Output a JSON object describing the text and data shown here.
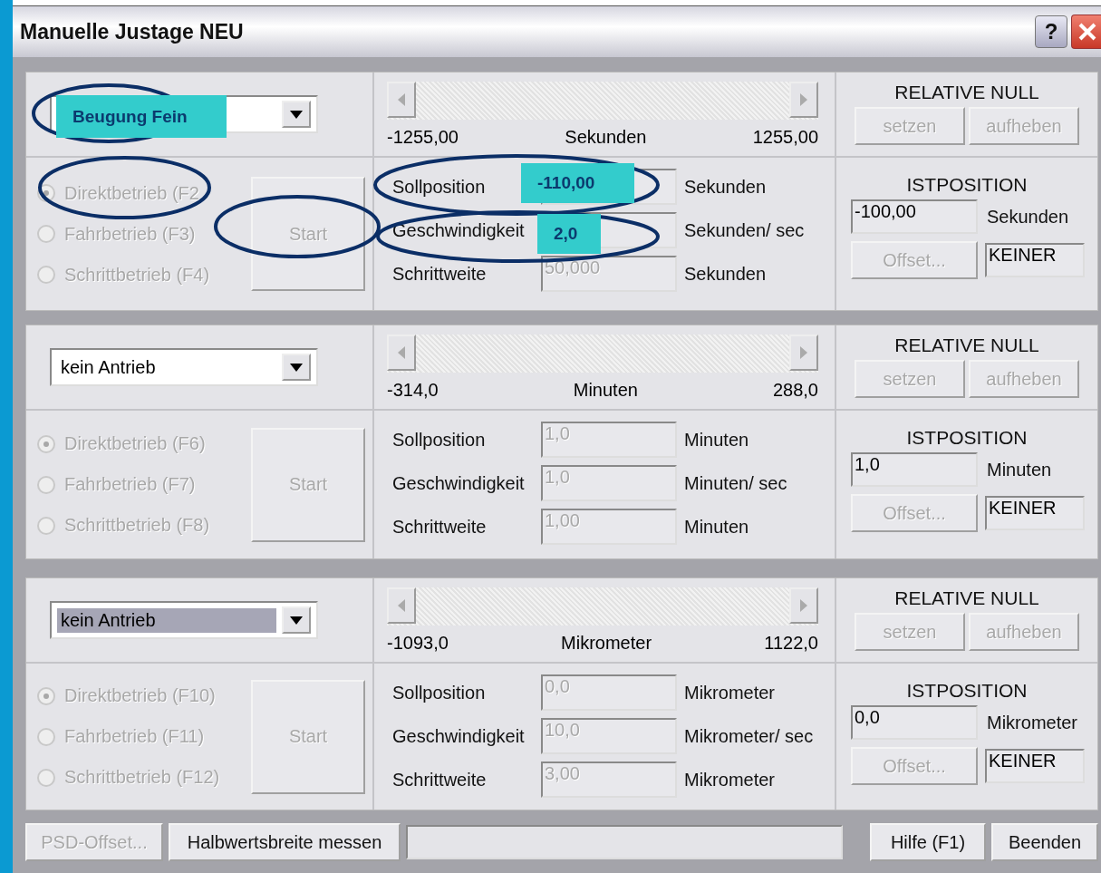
{
  "window": {
    "title": "Manuelle Justage NEU",
    "buttons": [
      "?"
    ]
  },
  "sections": [
    {
      "drive": {
        "highlighted": false
      },
      "scroll": {
        "min": "-1255,00",
        "unit": "Sekunden",
        "max": "1255,00"
      },
      "relative_null": {
        "title": "RELATIVE NULL",
        "buttons": [
          "setzen",
          "aufheben"
        ]
      },
      "modes": [
        {
          "label": "Direktbetrieb (F2",
          "checked": true
        },
        {
          "label": "Fahrbetrieb (F3)",
          "checked": false
        },
        {
          "label": "Schrittbetrieb (F4)",
          "checked": false
        }
      ],
      "start_button": "Start",
      "fields": [
        {
          "label": "Sollposition",
          "unit": "Sekunden"
        },
        {
          "label": "Geschwindigkeit",
          "unit": "Sekunden/ sec"
        },
        {
          "label": "Schrittweite",
          "value": "50,000",
          "unit": "Sekunden"
        }
      ],
      "istposition": {
        "title": "ISTPOSITION",
        "value": "-100,00",
        "unit": "Sekunden"
      },
      "offset_button": "Offset...",
      "offset_mode": "KEINER"
    },
    {
      "drive": {
        "value": "kein Antrieb",
        "highlighted": false
      },
      "scroll": {
        "min": "-314,0",
        "unit": "Minuten",
        "max": "288,0"
      },
      "relative_null": {
        "title": "RELATIVE NULL",
        "buttons": [
          "setzen",
          "aufheben"
        ]
      },
      "modes": [
        {
          "label": "Direktbetrieb (F6)",
          "checked": true
        },
        {
          "label": "Fahrbetrieb (F7)",
          "checked": false
        },
        {
          "label": "Schrittbetrieb (F8)",
          "checked": false
        }
      ],
      "start_button": "Start",
      "fields": [
        {
          "label": "Sollposition",
          "value": "1,0",
          "unit": "Minuten"
        },
        {
          "label": "Geschwindigkeit",
          "value": "1,0",
          "unit": "Minuten/ sec"
        },
        {
          "label": "Schrittweite",
          "value": "1,00",
          "unit": "Minuten"
        }
      ],
      "istposition": {
        "title": "ISTPOSITION",
        "value": "1,0",
        "unit": "Minuten"
      },
      "offset_button": "Offset...",
      "offset_mode": "KEINER"
    },
    {
      "drive": {
        "value": "kein Antrieb",
        "highlighted": true
      },
      "scroll": {
        "min": "-1093,0",
        "unit": "Mikrometer",
        "max": "1122,0"
      },
      "relative_null": {
        "title": "RELATIVE NULL",
        "buttons": [
          "setzen",
          "aufheben"
        ]
      },
      "modes": [
        {
          "label": "Direktbetrieb (F10)",
          "checked": true
        },
        {
          "label": "Fahrbetrieb (F11)",
          "checked": false
        },
        {
          "label": "Schrittbetrieb (F12)",
          "checked": false
        }
      ],
      "start_button": "Start",
      "fields": [
        {
          "label": "Sollposition",
          "value": "0,0",
          "unit": "Mikrometer"
        },
        {
          "label": "Geschwindigkeit",
          "value": "10,0",
          "unit": "Mikrometer/ sec"
        },
        {
          "label": "Schrittweite",
          "value": "3,00",
          "unit": "Mikrometer"
        }
      ],
      "istposition": {
        "title": "ISTPOSITION",
        "value": "0,0",
        "unit": "Mikrometer"
      },
      "offset_button": "Offset...",
      "offset_mode": "KEINER"
    }
  ],
  "bottom_bar": {
    "psd_button": "PSD-Offset...",
    "measure_button": "Halbwertsbreite messen",
    "help_button": "Hilfe (F1)",
    "close_button": "Beenden"
  },
  "annotations": [
    {
      "text": "Beugung Fein"
    },
    {
      "text": "-110,00"
    },
    {
      "text": "2,0"
    }
  ]
}
